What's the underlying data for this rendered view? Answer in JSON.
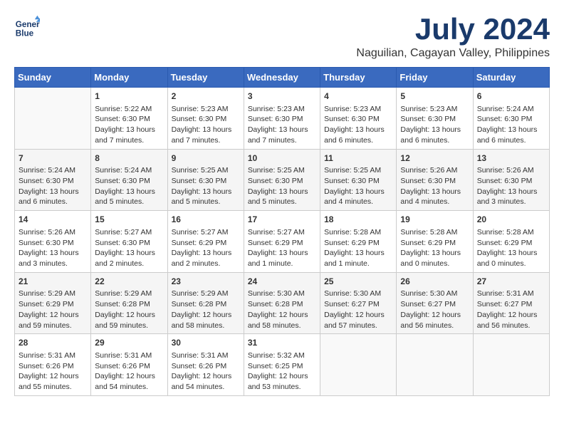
{
  "header": {
    "logo_line1": "General",
    "logo_line2": "Blue",
    "month_year": "July 2024",
    "location": "Naguilian, Cagayan Valley, Philippines"
  },
  "calendar": {
    "days_of_week": [
      "Sunday",
      "Monday",
      "Tuesday",
      "Wednesday",
      "Thursday",
      "Friday",
      "Saturday"
    ],
    "weeks": [
      [
        {
          "day": "",
          "data": ""
        },
        {
          "day": "1",
          "data": "Sunrise: 5:22 AM\nSunset: 6:30 PM\nDaylight: 13 hours\nand 7 minutes."
        },
        {
          "day": "2",
          "data": "Sunrise: 5:23 AM\nSunset: 6:30 PM\nDaylight: 13 hours\nand 7 minutes."
        },
        {
          "day": "3",
          "data": "Sunrise: 5:23 AM\nSunset: 6:30 PM\nDaylight: 13 hours\nand 7 minutes."
        },
        {
          "day": "4",
          "data": "Sunrise: 5:23 AM\nSunset: 6:30 PM\nDaylight: 13 hours\nand 6 minutes."
        },
        {
          "day": "5",
          "data": "Sunrise: 5:23 AM\nSunset: 6:30 PM\nDaylight: 13 hours\nand 6 minutes."
        },
        {
          "day": "6",
          "data": "Sunrise: 5:24 AM\nSunset: 6:30 PM\nDaylight: 13 hours\nand 6 minutes."
        }
      ],
      [
        {
          "day": "7",
          "data": "Sunrise: 5:24 AM\nSunset: 6:30 PM\nDaylight: 13 hours\nand 6 minutes."
        },
        {
          "day": "8",
          "data": "Sunrise: 5:24 AM\nSunset: 6:30 PM\nDaylight: 13 hours\nand 5 minutes."
        },
        {
          "day": "9",
          "data": "Sunrise: 5:25 AM\nSunset: 6:30 PM\nDaylight: 13 hours\nand 5 minutes."
        },
        {
          "day": "10",
          "data": "Sunrise: 5:25 AM\nSunset: 6:30 PM\nDaylight: 13 hours\nand 5 minutes."
        },
        {
          "day": "11",
          "data": "Sunrise: 5:25 AM\nSunset: 6:30 PM\nDaylight: 13 hours\nand 4 minutes."
        },
        {
          "day": "12",
          "data": "Sunrise: 5:26 AM\nSunset: 6:30 PM\nDaylight: 13 hours\nand 4 minutes."
        },
        {
          "day": "13",
          "data": "Sunrise: 5:26 AM\nSunset: 6:30 PM\nDaylight: 13 hours\nand 3 minutes."
        }
      ],
      [
        {
          "day": "14",
          "data": "Sunrise: 5:26 AM\nSunset: 6:30 PM\nDaylight: 13 hours\nand 3 minutes."
        },
        {
          "day": "15",
          "data": "Sunrise: 5:27 AM\nSunset: 6:30 PM\nDaylight: 13 hours\nand 2 minutes."
        },
        {
          "day": "16",
          "data": "Sunrise: 5:27 AM\nSunset: 6:29 PM\nDaylight: 13 hours\nand 2 minutes."
        },
        {
          "day": "17",
          "data": "Sunrise: 5:27 AM\nSunset: 6:29 PM\nDaylight: 13 hours\nand 1 minute."
        },
        {
          "day": "18",
          "data": "Sunrise: 5:28 AM\nSunset: 6:29 PM\nDaylight: 13 hours\nand 1 minute."
        },
        {
          "day": "19",
          "data": "Sunrise: 5:28 AM\nSunset: 6:29 PM\nDaylight: 13 hours\nand 0 minutes."
        },
        {
          "day": "20",
          "data": "Sunrise: 5:28 AM\nSunset: 6:29 PM\nDaylight: 13 hours\nand 0 minutes."
        }
      ],
      [
        {
          "day": "21",
          "data": "Sunrise: 5:29 AM\nSunset: 6:29 PM\nDaylight: 12 hours\nand 59 minutes."
        },
        {
          "day": "22",
          "data": "Sunrise: 5:29 AM\nSunset: 6:28 PM\nDaylight: 12 hours\nand 59 minutes."
        },
        {
          "day": "23",
          "data": "Sunrise: 5:29 AM\nSunset: 6:28 PM\nDaylight: 12 hours\nand 58 minutes."
        },
        {
          "day": "24",
          "data": "Sunrise: 5:30 AM\nSunset: 6:28 PM\nDaylight: 12 hours\nand 58 minutes."
        },
        {
          "day": "25",
          "data": "Sunrise: 5:30 AM\nSunset: 6:27 PM\nDaylight: 12 hours\nand 57 minutes."
        },
        {
          "day": "26",
          "data": "Sunrise: 5:30 AM\nSunset: 6:27 PM\nDaylight: 12 hours\nand 56 minutes."
        },
        {
          "day": "27",
          "data": "Sunrise: 5:31 AM\nSunset: 6:27 PM\nDaylight: 12 hours\nand 56 minutes."
        }
      ],
      [
        {
          "day": "28",
          "data": "Sunrise: 5:31 AM\nSunset: 6:26 PM\nDaylight: 12 hours\nand 55 minutes."
        },
        {
          "day": "29",
          "data": "Sunrise: 5:31 AM\nSunset: 6:26 PM\nDaylight: 12 hours\nand 54 minutes."
        },
        {
          "day": "30",
          "data": "Sunrise: 5:31 AM\nSunset: 6:26 PM\nDaylight: 12 hours\nand 54 minutes."
        },
        {
          "day": "31",
          "data": "Sunrise: 5:32 AM\nSunset: 6:25 PM\nDaylight: 12 hours\nand 53 minutes."
        },
        {
          "day": "",
          "data": ""
        },
        {
          "day": "",
          "data": ""
        },
        {
          "day": "",
          "data": ""
        }
      ]
    ]
  }
}
